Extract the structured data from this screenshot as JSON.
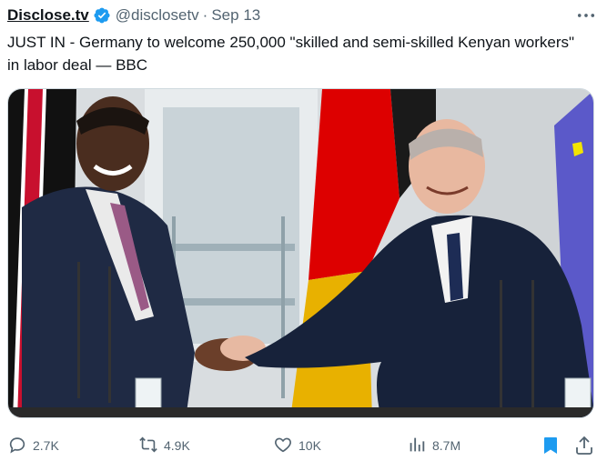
{
  "tweet": {
    "display_name": "Disclose.tv",
    "handle": "@disclosetv",
    "separator": "·",
    "date": "Sep 13",
    "text": "JUST IN - Germany to welcome 250,000 \"skilled and semi-skilled Kenyan workers\" in labor deal — BBC",
    "verified_icon": "verified-badge-icon",
    "more_icon": "more-horizontal-icon"
  },
  "actions": {
    "reply": {
      "icon": "reply-icon",
      "count": "2.7K"
    },
    "repost": {
      "icon": "repost-icon",
      "count": "4.9K"
    },
    "like": {
      "icon": "heart-icon",
      "count": "10K"
    },
    "views": {
      "icon": "views-chart-icon",
      "count": "8.7M"
    },
    "bookmark": {
      "icon": "bookmark-icon"
    },
    "share": {
      "icon": "share-icon"
    }
  },
  "colors": {
    "accent": "#1d9bf0",
    "secondary_text": "#536471",
    "bookmark_active": "#1d9bf0"
  }
}
